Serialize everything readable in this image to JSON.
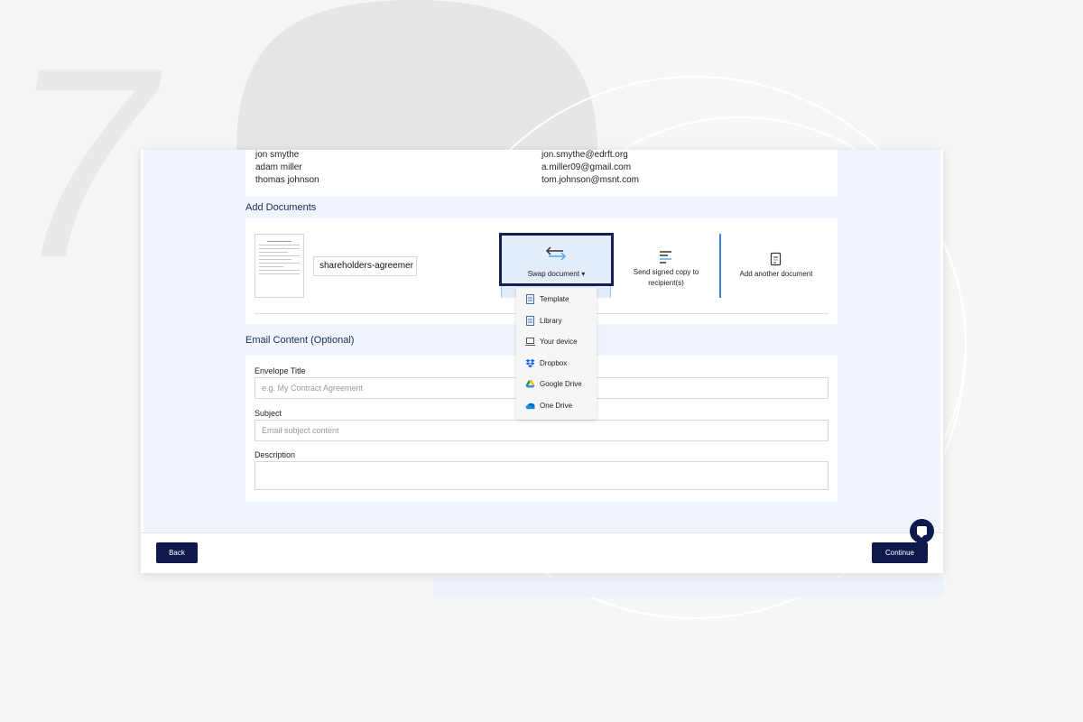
{
  "background": {
    "step_number": "7"
  },
  "recipients": [
    {
      "name": "jon smythe",
      "email": "jon.smythe@edrft.org"
    },
    {
      "name": "adam miller",
      "email": "a.miller09@gmail.com"
    },
    {
      "name": "thomas johnson",
      "email": "tom.johnson@msnt.com"
    }
  ],
  "documents": {
    "section_title": "Add Documents",
    "file_name": "shareholders-agreemer",
    "swap_label": "Swap document ▾",
    "send_copy_label_line1": "Send signed copy to",
    "send_copy_label_line2": "recipient(s)",
    "add_another_label": "Add another document"
  },
  "swap_menu": {
    "items": [
      {
        "label": "Template",
        "icon": "document-icon"
      },
      {
        "label": "Library",
        "icon": "document-icon"
      },
      {
        "label": "Your device",
        "icon": "laptop-icon"
      },
      {
        "label": "Dropbox",
        "icon": "dropbox-icon"
      },
      {
        "label": "Google Drive",
        "icon": "google-drive-icon"
      },
      {
        "label": "One Drive",
        "icon": "onedrive-icon"
      }
    ]
  },
  "email_content": {
    "section_title": "Email Content (Optional)",
    "envelope_title_label": "Envelope Title",
    "envelope_title_placeholder": "e.g. My Contract Agreement",
    "subject_label": "Subject",
    "subject_placeholder": "Email subject content",
    "description_label": "Description",
    "description_value": ""
  },
  "footer": {
    "back_label": "Back",
    "continue_label": "Continue"
  },
  "colors": {
    "primary": "#0e1a4b",
    "accent_blue": "#3a86d6",
    "content_bg": "#eff4fd"
  }
}
